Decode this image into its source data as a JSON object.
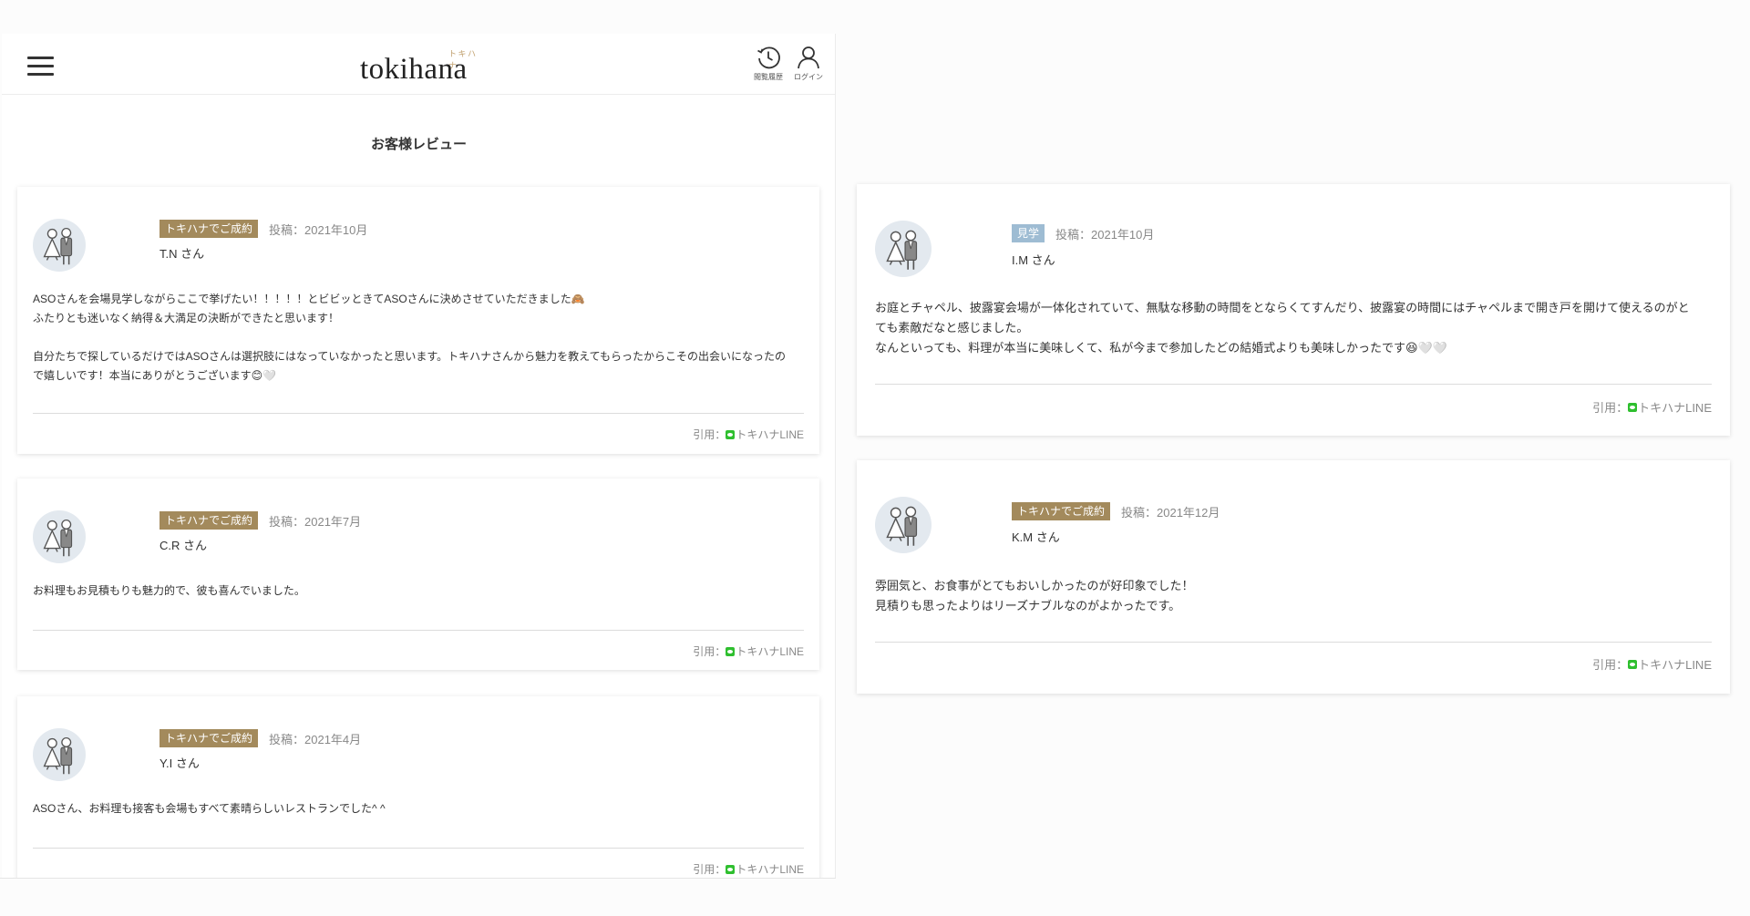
{
  "header": {
    "logo_text": "tokihana",
    "logo_kana": "トキハナ",
    "history_label": "閲覧履歴",
    "login_label": "ログイン"
  },
  "page_title": "お客様レビュー",
  "reviews": [
    {
      "badge": "トキハナでご成約",
      "posted": "投稿：2021年10月",
      "author": "T.N さん",
      "body_lines": [
        "ASOさんを会場見学しながらここで挙げたい！！！！！とビビッときてASOさんに決めさせていただきました🙈",
        "ふたりとも迷いなく納得＆大満足の決断ができたと思います！",
        "",
        "自分たちで探しているだけではASOさんは選択肢にはなっていなかったと思います。トキハナさんから魅力を教えてもらったからこその出会いになったの",
        "で嬉しいです！本当にありがとうございます😊🤍"
      ],
      "citation_prefix": "引用：",
      "citation_source": "トキハナLINE"
    },
    {
      "badge": "トキハナでご成約",
      "posted": "投稿：2021年7月",
      "author": "C.R さん",
      "body_lines": [
        "お料理もお見積もりも魅力的で、彼も喜んでいました。"
      ],
      "citation_prefix": "引用：",
      "citation_source": "トキハナLINE"
    },
    {
      "badge": "トキハナでご成約",
      "posted": "投稿：2021年4月",
      "author": "Y.I さん",
      "body_lines": [
        "ASOさん、お料理も接客も会場もすべて素晴らしいレストランでした^ ^"
      ],
      "citation_prefix": "引用：",
      "citation_source": "トキハナLINE"
    },
    {
      "badge": "見学",
      "posted": "投稿：2021年10月",
      "author": "I.M さん",
      "body_lines": [
        "お庭とチャペル、披露宴会場が一体化されていて、無駄な移動の時間をとならくてすんだり、披露宴の時間にはチャペルまで開き戸を開けて使えるのがと",
        "ても素敵だなと感じました。",
        "なんといっても、料理が本当に美味しくて、私が今まで参加したどの結婚式よりも美味しかったです😆🤍🤍"
      ],
      "citation_prefix": "引用：",
      "citation_source": "トキハナLINE"
    },
    {
      "badge": "トキハナでご成約",
      "posted": "投稿：2021年12月",
      "author": "K.M さん",
      "body_lines": [
        "雰囲気と、お食事がとてもおいしかったのが好印象でした！",
        "見積りも思ったよりはリーズナブルなのがよかったです。"
      ],
      "citation_prefix": "引用：",
      "citation_source": "トキハナLINE"
    }
  ],
  "colors": {
    "badge_contract": "#a38a5c",
    "badge_visit": "#9ebcd3",
    "line_green": "#2fbf2f",
    "logo_accent": "#c2a271"
  },
  "icons": {
    "menu": "hamburger-menu-icon",
    "history": "clock-history-icon",
    "login": "user-icon",
    "avatar": "couple-avatar-icon",
    "line": "line-app-icon"
  }
}
